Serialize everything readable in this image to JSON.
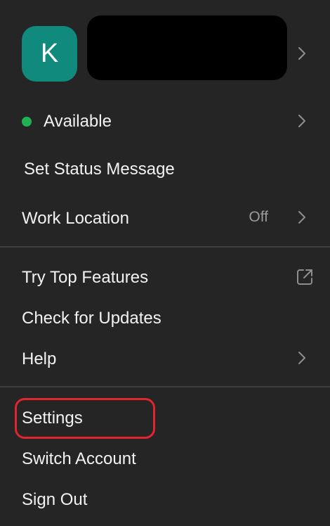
{
  "profile": {
    "avatar_initial": "K",
    "avatar_color": "#0f8a7c"
  },
  "status": {
    "label": "Available",
    "indicator_color": "#1fb254"
  },
  "menu": {
    "set_status_message": "Set Status Message",
    "work_location": "Work Location",
    "work_location_value": "Off",
    "try_top_features": "Try Top Features",
    "check_for_updates": "Check for Updates",
    "help": "Help",
    "settings": "Settings",
    "switch_account": "Switch Account",
    "sign_out": "Sign Out"
  },
  "icons": {
    "chevron": "chevron-right-icon",
    "external": "external-link-icon"
  },
  "highlight_color": "#e0252f"
}
